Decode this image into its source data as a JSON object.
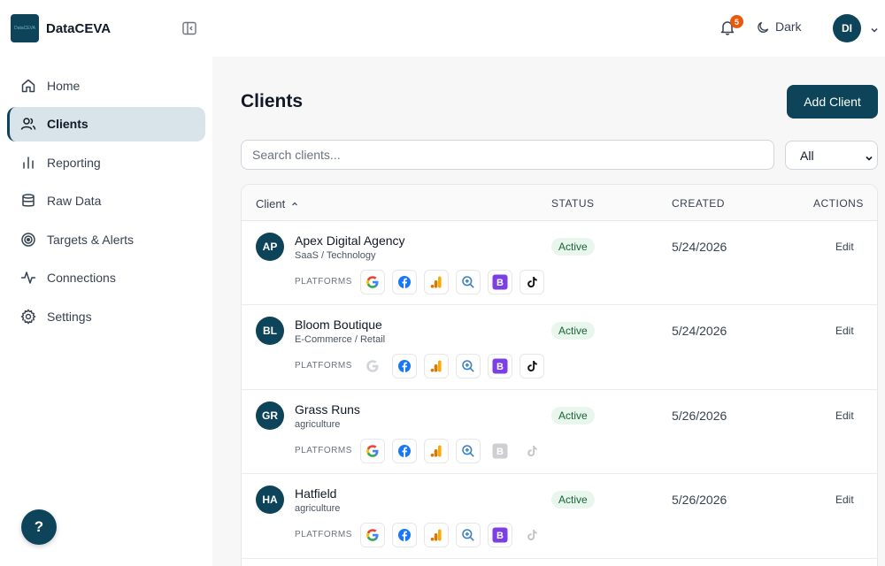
{
  "brand": {
    "logo_text": "DataCEVA",
    "name": "DataCEVA"
  },
  "sidebar": {
    "items": [
      {
        "label": "Home",
        "icon": "home-icon",
        "active": false
      },
      {
        "label": "Clients",
        "icon": "users-icon",
        "active": true
      },
      {
        "label": "Reporting",
        "icon": "bar-chart-icon",
        "active": false
      },
      {
        "label": "Raw Data",
        "icon": "database-icon",
        "active": false
      },
      {
        "label": "Targets & Alerts",
        "icon": "target-icon",
        "active": false
      },
      {
        "label": "Connections",
        "icon": "activity-icon",
        "active": false
      },
      {
        "label": "Settings",
        "icon": "gear-icon",
        "active": false
      }
    ],
    "help_label": "?"
  },
  "topbar": {
    "notification_count": "5",
    "theme_label": "Dark",
    "user_initials": "DI"
  },
  "page": {
    "title": "Clients",
    "add_button": "Add Client",
    "search_placeholder": "Search clients...",
    "filter_value": "All"
  },
  "table": {
    "headers": {
      "client": "Client",
      "status": "STATUS",
      "created": "CREATED",
      "actions": "ACTIONS"
    },
    "platforms_label": "PLATFORMS",
    "rows": [
      {
        "initials": "AP",
        "name": "Apex Digital Agency",
        "category": "SaaS / Technology",
        "status": "Active",
        "created": "5/24/2026",
        "action": "Edit",
        "platforms": {
          "google": true,
          "facebook": true,
          "analytics": true,
          "search": true,
          "bing": true,
          "tiktok": true
        }
      },
      {
        "initials": "BL",
        "name": "Bloom Boutique",
        "category": "E-Commerce / Retail",
        "status": "Active",
        "created": "5/24/2026",
        "action": "Edit",
        "platforms": {
          "google": false,
          "facebook": true,
          "analytics": true,
          "search": true,
          "bing": true,
          "tiktok": true
        }
      },
      {
        "initials": "GR",
        "name": "Grass Runs",
        "category": "agriculture",
        "status": "Active",
        "created": "5/26/2026",
        "action": "Edit",
        "platforms": {
          "google": true,
          "facebook": true,
          "analytics": true,
          "search": true,
          "bing": false,
          "tiktok": false
        }
      },
      {
        "initials": "HA",
        "name": "Hatfield",
        "category": "agriculture",
        "status": "Active",
        "created": "5/26/2026",
        "action": "Edit",
        "platforms": {
          "google": true,
          "facebook": true,
          "analytics": true,
          "search": true,
          "bing": true,
          "tiktok": false
        }
      }
    ]
  },
  "colors": {
    "brand": "#0d4459",
    "badge": "#ea580c",
    "active_bg": "#e9f6ee",
    "active_text": "#166534",
    "bing": "#7b3fe4"
  }
}
